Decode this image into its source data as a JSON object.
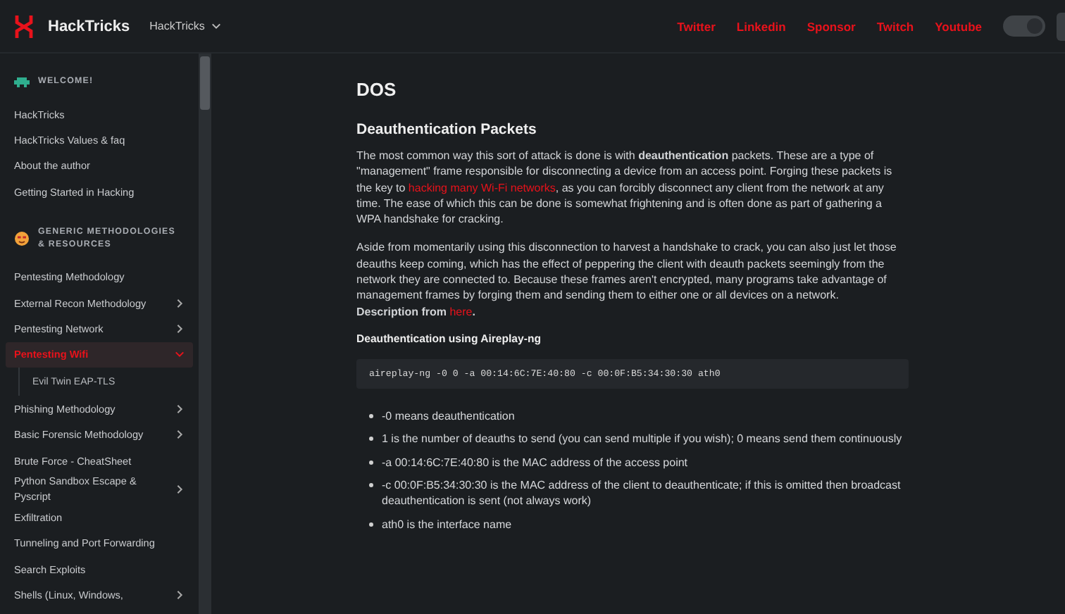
{
  "header": {
    "logo_text": "HackTricks",
    "book_menu": "HackTricks",
    "links": [
      "Twitter",
      "Linkedin",
      "Sponsor",
      "Twitch",
      "Youtube"
    ],
    "theme_toggle": {
      "on": true
    }
  },
  "sidebar": {
    "sections": [
      {
        "title": "WELCOME!",
        "kind": "invader",
        "items": [
          {
            "label": "HackTricks",
            "has_children": false,
            "selected": false
          },
          {
            "label": "HackTricks Values & faq",
            "has_children": false,
            "selected": false
          },
          {
            "label": "About the author",
            "has_children": false,
            "selected": false
          },
          {
            "label": "Getting Started in Hacking",
            "has_children": false,
            "selected": false
          }
        ]
      },
      {
        "title": "GENERIC METHODOLOGIES & RESOURCES",
        "kind": "face",
        "items": [
          {
            "label": "Pentesting Methodology",
            "has_children": false,
            "selected": false
          },
          {
            "label": "External Recon Methodology",
            "has_children": true,
            "selected": false,
            "expanded": false
          },
          {
            "label": "Pentesting Network",
            "has_children": true,
            "selected": false,
            "expanded": false
          },
          {
            "label": "Pentesting Wifi",
            "has_children": true,
            "selected": true,
            "expanded": true,
            "children": [
              {
                "label": "Evil Twin EAP-TLS",
                "selected": false
              }
            ]
          },
          {
            "label": "Phishing Methodology",
            "has_children": true,
            "selected": false,
            "expanded": false
          },
          {
            "label": "Basic Forensic Methodology",
            "has_children": true,
            "selected": false,
            "expanded": false
          },
          {
            "label": "Brute Force - CheatSheet",
            "has_children": false,
            "selected": false
          },
          {
            "label": "Python Sandbox Escape & Pyscript",
            "has_children": true,
            "selected": false,
            "expanded": false
          },
          {
            "label": "Exfiltration",
            "has_children": false,
            "selected": false
          },
          {
            "label": "Tunneling and Port Forwarding",
            "has_children": false,
            "selected": false
          },
          {
            "label": "Search Exploits",
            "has_children": false,
            "selected": false
          },
          {
            "label": "Shells (Linux, Windows,",
            "has_children": true,
            "selected": false,
            "expanded": false
          }
        ]
      }
    ]
  },
  "content": {
    "blocks": [
      {
        "kind": "h1",
        "text": "DOS"
      },
      {
        "kind": "h2",
        "text": "Deauthentication Packets"
      },
      {
        "kind": "paragraph",
        "parts": [
          {
            "kind": "text",
            "text": "The most common way this sort of attack is done is with "
          },
          {
            "kind": "bold",
            "text": "deauthentication"
          },
          {
            "kind": "text",
            "text": " packets. These are a type of \"management\" frame responsible for disconnecting a device from an access point. Forging these packets is the key to "
          },
          {
            "kind": "link",
            "text": "hacking many Wi-Fi networks"
          },
          {
            "kind": "text",
            "text": ", as you can forcibly disconnect any client from the network at any time. The ease of which this can be done is somewhat frightening and is often done as part of gathering a WPA handshake for cracking."
          }
        ]
      },
      {
        "kind": "paragraph",
        "parts": [
          {
            "kind": "text",
            "text": "Aside from momentarily using this disconnection to harvest a handshake to crack, you can also just let those deauths keep coming, which has the effect of peppering the client with deauth packets seemingly from the network they are connected to. Because these frames aren't encrypted, many programs take advantage of management frames by forging them and sending them to either one or all devices on a network."
          }
        ]
      },
      {
        "kind": "source_line",
        "parts": [
          {
            "kind": "bold",
            "text": "Description from "
          },
          {
            "kind": "link",
            "text": "here"
          },
          {
            "kind": "bold",
            "text": "."
          }
        ]
      },
      {
        "kind": "h3",
        "text": "Deauthentication using Aireplay-ng"
      },
      {
        "kind": "code",
        "text": "aireplay-ng -0 0 -a 00:14:6C:7E:40:80 -c 00:0F:B5:34:30:30 ath0"
      },
      {
        "kind": "list",
        "items": [
          "-0 means deauthentication",
          "1 is the number of deauths to send (you can send multiple if you wish); 0 means send them continuously",
          "-a 00:14:6C:7E:40:80 is the MAC address of the access point",
          "-c 00:0F:B5:34:30:30 is the MAC address of the client to deauthenticate; if this is omitted then broadcast deauthentication is sent (not always work)",
          "ath0 is the interface name"
        ]
      }
    ]
  }
}
